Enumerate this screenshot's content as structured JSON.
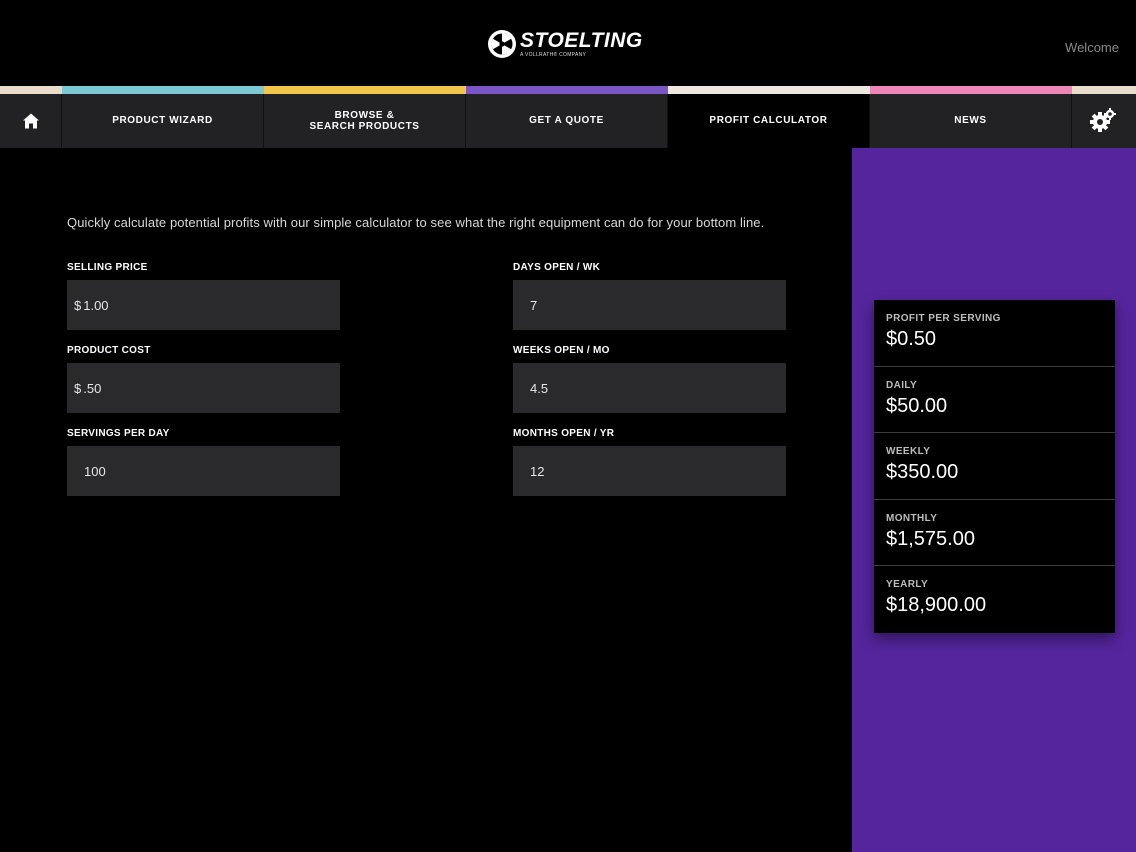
{
  "header": {
    "brand": "STOELTING",
    "brand_tagline": "A VOLLRATH® COMPANY",
    "welcome": "Welcome"
  },
  "strip_colors": [
    "#e9dccb",
    "#7ec9d6",
    "#f1c64a",
    "#7a56c4",
    "#ece7df",
    "#ee86b7",
    "#e8dccd"
  ],
  "nav": {
    "home_icon": "home-icon",
    "items": [
      {
        "label": "PRODUCT WIZARD"
      },
      {
        "label": "BROWSE &\nSEARCH PRODUCTS"
      },
      {
        "label": "GET A QUOTE"
      },
      {
        "label": "PROFIT CALCULATOR",
        "active": true
      },
      {
        "label": "NEWS"
      }
    ],
    "settings_icon": "gear-icon"
  },
  "intro": "Quickly calculate potential profits with our simple calculator to see what the right equipment can do for your bottom line.",
  "fields": {
    "selling_price": {
      "label": "SELLING PRICE",
      "prefix": "$",
      "value": "1.00"
    },
    "product_cost": {
      "label": "PRODUCT COST",
      "prefix": "$",
      "value": ".50"
    },
    "servings_per_day": {
      "label": "SERVINGS PER DAY",
      "value": "100"
    },
    "days_open": {
      "label": "DAYS OPEN / WK",
      "value": "7"
    },
    "weeks_open": {
      "label": "WEEKS OPEN / MO",
      "value": "4.5"
    },
    "months_open": {
      "label": "MONTHS OPEN / YR",
      "value": "12"
    }
  },
  "results": {
    "profit_per_serving": {
      "label": "PROFIT PER SERVING",
      "value": "$0.50"
    },
    "daily": {
      "label": "DAILY",
      "value": "$50.00"
    },
    "weekly": {
      "label": "WEEKLY",
      "value": "$350.00"
    },
    "monthly": {
      "label": "MONTHLY",
      "value": "$1,575.00"
    },
    "yearly": {
      "label": "YEARLY",
      "value": "$18,900.00"
    }
  },
  "colors": {
    "accent_panel": "#55259e",
    "field_bg": "#2a2a2c",
    "nav_bg": "#222224"
  }
}
